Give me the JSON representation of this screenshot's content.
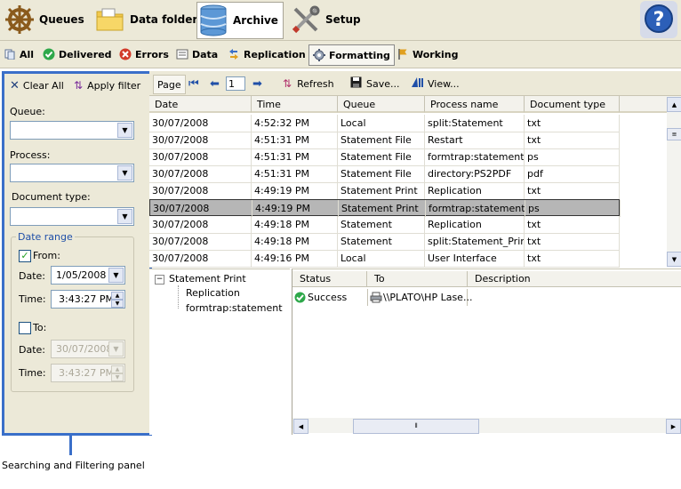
{
  "toolbar": {
    "items": [
      {
        "label": "Queues",
        "icon": "ships-wheel-icon"
      },
      {
        "label": "Data folders",
        "icon": "folder-icon"
      },
      {
        "label": "Archive",
        "icon": "database-icon",
        "active": true
      },
      {
        "label": "Setup",
        "icon": "tools-icon"
      }
    ],
    "help_icon": "help-icon"
  },
  "filters": [
    {
      "label": "All",
      "icon": "documents-icon"
    },
    {
      "label": "Delivered",
      "icon": "check-icon"
    },
    {
      "label": "Errors",
      "icon": "error-icon"
    },
    {
      "label": "Data",
      "icon": "data-icon"
    },
    {
      "label": "Replication",
      "icon": "replication-icon"
    },
    {
      "label": "Formatting",
      "icon": "gear-icon",
      "active": true
    },
    {
      "label": "Working",
      "icon": "flag-icon"
    }
  ],
  "search_panel": {
    "clear_label": "Clear All",
    "apply_label": "Apply filter",
    "queue_label": "Queue:",
    "process_label": "Process:",
    "doctype_label": "Document type:",
    "date_range_label": "Date range",
    "from_label": "From:",
    "from_checked": true,
    "from_date_label": "Date:",
    "from_date_value": "1/05/2008",
    "from_time_label": "Time:",
    "from_time_value": "3:43:27 PM",
    "to_label": "To:",
    "to_checked": false,
    "to_date_label": "Date:",
    "to_date_value": "30/07/2008",
    "to_time_label": "Time:",
    "to_time_value": "3:43:27 PM"
  },
  "grid_toolbar": {
    "page_label": "Page",
    "page_value": "1",
    "refresh_label": "Refresh",
    "save_label": "Save...",
    "view_label": "View..."
  },
  "grid": {
    "columns": [
      "Date",
      "Time",
      "Queue",
      "Process name",
      "Document type"
    ],
    "rows": [
      [
        "30/07/2008",
        "4:52:32 PM",
        "Local",
        "split:Statement",
        "txt"
      ],
      [
        "30/07/2008",
        "4:51:31 PM",
        "Statement File",
        "Restart",
        "txt"
      ],
      [
        "30/07/2008",
        "4:51:31 PM",
        "Statement File",
        "formtrap:statement",
        "ps"
      ],
      [
        "30/07/2008",
        "4:51:31 PM",
        "Statement File",
        "directory:PS2PDF",
        "pdf"
      ],
      [
        "30/07/2008",
        "4:49:19 PM",
        "Statement Print",
        "Replication",
        "txt"
      ],
      [
        "30/07/2008",
        "4:49:19 PM",
        "Statement Print",
        "formtrap:statement",
        "ps"
      ],
      [
        "30/07/2008",
        "4:49:18 PM",
        "Statement",
        "Replication",
        "txt"
      ],
      [
        "30/07/2008",
        "4:49:18 PM",
        "Statement",
        "split:Statement_Print",
        "txt"
      ],
      [
        "30/07/2008",
        "4:49:16 PM",
        "Local",
        "User Interface",
        "txt"
      ]
    ],
    "selected_row": 5
  },
  "tree": {
    "root": "Statement Print",
    "children": [
      "Replication",
      "formtrap:statement"
    ]
  },
  "status_table": {
    "columns": [
      "Status",
      "To",
      "Description"
    ],
    "rows": [
      {
        "status": "Success",
        "to": "\\\\PLATO\\HP Lase...",
        "description": ""
      }
    ]
  },
  "caption": "Searching and Filtering panel",
  "colors": {
    "accent": "#3a6fc9",
    "toolbar_bg": "#ece9d8",
    "selected_row": "#b6b6b6"
  }
}
